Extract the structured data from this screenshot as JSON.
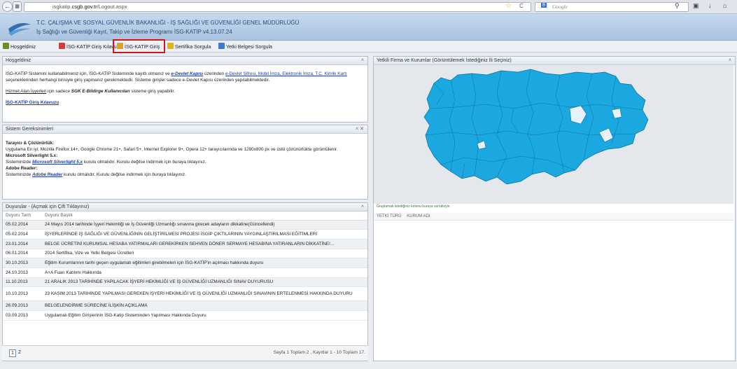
{
  "browser": {
    "url_prefix": "isgkatip.",
    "url_domain": "csgb.gov.tr",
    "url_path": "/Logout.aspx",
    "search_placeholder": "Google"
  },
  "header": {
    "title_line1": "T.C. ÇALIŞMA VE SOSYAL GÜVENLİK BAKANLIĞI - İŞ SAĞLIĞI VE GÜVENLİĞİ GENEL MÜDÜRLÜĞÜ",
    "title_line2": "İş Sağlığı ve Güvenliği Kayıt, Takip ve İzleme Programı İSG-KATİP v4.13.07.24"
  },
  "nav": {
    "items": [
      {
        "label": "Hoşgeldiniz",
        "color": "#6b8e23"
      },
      {
        "label": "İSG-KATİP Giriş Kılavuzu",
        "color": "#d43a3a"
      },
      {
        "label": "İSG-KATİP Giriş",
        "color": "#e0a020"
      },
      {
        "label": "Sertifika Sorgula",
        "color": "#e8b400"
      },
      {
        "label": "Yetki Belgesi Sorgula",
        "color": "#3a7bd5"
      }
    ]
  },
  "welcome": {
    "title": "Hoşgeldiniz",
    "p1_a": "İSG-KATİP Sistemini kullanabilmeniz için, İSG-KATİP Sisteminde kayıtlı olmanız ve ",
    "p1_link1": "e-Devlet Kapısı",
    "p1_b": " üzerinden ",
    "p1_link2": "e-Devlet Şifresi, Mobil İmza, Elektronik İmza, T.C. Kimlik Kartı",
    "p1_c": " seçeneklerinden herhangi birisiyle giriş yapmanız gerekmektedir. Sisteme girişler sadece e-Devlet Kapısı üzerinden yapılabilmektedir.",
    "p2_link": "Hizmet Alan İşyerleri",
    "p2_a": " için sadece ",
    "p2_bold": "SGK E-Bildirge Kullanıcıları",
    "p2_b": " sisteme giriş yapabilir.",
    "guide_link": "İSG-KATİP Giriş Kılavuzu"
  },
  "system": {
    "title": "Sistem Gereksinimleri",
    "h1": "Tarayıcı & Çözünürlük:",
    "t1": "Uygulama En iyi; Mozilla Firefox 14+, Google Chrome 21+, Safari 5+, Internet Explorer 9+, Opera 12+ tarayıcılarında ve 1280x800 px ve üstü çözünürlükte görüntülenir.",
    "h2": "Microsoft Silverlight 5.x:",
    "t2a": "Sisteminizde ",
    "t2link": "Microsoft Silverlight 5.x",
    "t2b": " kurulu olmalıdır. Kurulu değilse indirmek için buraya tıklayınız.",
    "h3": "Adobe Reader:",
    "t3a": "Sisteminizde ",
    "t3link": "Adobe Reader",
    "t3b": " kurulu olmalıdır. Kurulu değilse indirmek için buraya tıklayınız."
  },
  "announcements": {
    "title": "Duyurular - (Açmak için Çift Tıklayınız)",
    "col_date": "Duyuru Tarih",
    "col_title": "Duyuru Başlık",
    "rows": [
      {
        "date": "05.02.2014",
        "title": "24 Mayıs 2014 tarihinde İşyeri Hekimliği ve İş Güvenliği Uzmanlığı sınavına girecek adayların dikkatine(Güncellendi)"
      },
      {
        "date": "05.02.2014",
        "title": "İŞYERLERİNDE İŞ SAĞLIĞI VE GÜVENLİĞİNİN GELİŞTİRİLMESİ PROJESİ İSGİP ÇIKTILARININ YAYGINLAŞTIRILMASI EĞİTİMLERİ"
      },
      {
        "date": "23.01.2014",
        "title": "BELGE ÜCRETİNİ KURUMSAL HESABA YATIRMALARI GEREKİRKEN SEHVEN DÖNER SERMAYE HESABINA YATIRANLARIN DİKKATİNE!..."
      },
      {
        "date": "06.01.2014",
        "title": "2014 Sertifika, Vize ve Yetki Belgesi Ücretleri"
      },
      {
        "date": "30.10.2013",
        "title": "Eğitim Kurumlarının tarihi geçen uygulamalı eğitimleri girebilmeleri için İSG-KATİP'in açılması hakkında duyuru"
      },
      {
        "date": "24.10.2013",
        "title": "A+A Fuarı Katılımı Hakkında"
      },
      {
        "date": "11.10.2013",
        "title": "21 ARALIK 2013 TARİHİNDE YAPILACAK İŞYERİ HEKİMLİĞİ VE İŞ GÜVENLİĞİ UZMANLIĞI SINAV DUYURUSU"
      },
      {
        "date": "10.10.2013",
        "title": "23 KASIM 2013 TARİHİNDE YAPILMASI GEREKEN İŞYERİ HEKİMLİĞİ VE İŞ GÜVENLİĞİ UZMANLIĞI SINAVININ ERTELENMESİ HAKKINDA DUYURU"
      },
      {
        "date": "26.09.2013",
        "title": "BELGELENDİRME SÜRECİNE İLİŞKİN AÇIKLAMA"
      },
      {
        "date": "03.09.2013",
        "title": "Uygulamalı Eğitim Girişlerinin İSG-Katip Sisteminden Yapılması Hakkında Duyuru"
      }
    ],
    "page1": "1",
    "page2": "2",
    "paging_text": "Sayfa 1 Toplam 2 , Kayıtlar 1 - 10 Toplam 17."
  },
  "right": {
    "title": "Yetkili Firma ve Kurumlar (Görüntülemek İstediğiniz İli Seçiniz)",
    "drag_hint": "Gruplamak istediğiniz kolonu buraya sürükleyin",
    "col1": "YETKİ TÜRÜ",
    "col2": "KURUM ADI",
    "map_color": "#1ba8e0",
    "highlight_color": "#e6f2f8"
  }
}
